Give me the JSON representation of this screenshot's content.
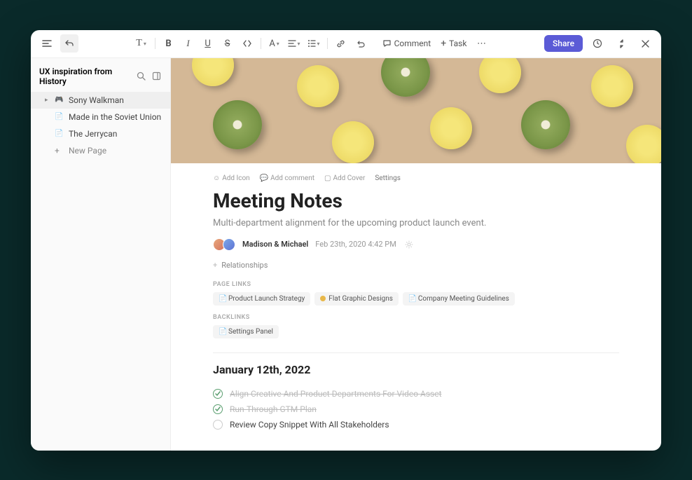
{
  "toolbar": {
    "comment": "Comment",
    "task": "Task",
    "share": "Share"
  },
  "sidebar": {
    "title": "UX inspiration from History",
    "items": [
      {
        "label": "Sony Walkman",
        "active": true,
        "icon": "gamepad"
      },
      {
        "label": "Made in the Soviet Union",
        "active": false,
        "icon": "page"
      },
      {
        "label": "The Jerrycan",
        "active": false,
        "icon": "page"
      }
    ],
    "new_page": "New Page"
  },
  "page": {
    "meta": {
      "add_icon": "Add Icon",
      "add_comment": "Add comment",
      "add_cover": "Add Cover",
      "settings": "Settings"
    },
    "title": "Meeting Notes",
    "subtitle": "Multi-department alignment for the upcoming product launch event.",
    "authors": "Madison & Michael",
    "date": "Feb 23th, 2020  4:42 PM",
    "relationships": "Relationships",
    "page_links_label": "PAGE LINKS",
    "page_links": [
      {
        "label": "Product Launch Strategy",
        "icon": "page"
      },
      {
        "label": "Flat Graphic Designs",
        "icon": "dot"
      },
      {
        "label": "Company Meeting Guidelines",
        "icon": "page"
      }
    ],
    "backlinks_label": "BACKLINKS",
    "backlinks": [
      {
        "label": "Settings Panel",
        "icon": "page"
      }
    ],
    "heading": "January 12th, 2022",
    "tasks": [
      {
        "text": "Align Creative And Product Departments For Video Asset",
        "done": true
      },
      {
        "text": "Run-Through GTM Plan",
        "done": true
      },
      {
        "text": "Review Copy Snippet With All Stakeholders",
        "done": false
      }
    ]
  }
}
